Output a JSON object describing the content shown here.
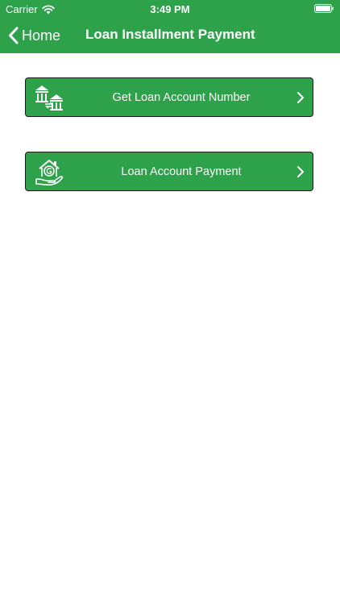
{
  "status_bar": {
    "carrier": "Carrier",
    "time": "3:49 PM"
  },
  "nav": {
    "back_label": "Home",
    "title": "Loan Installment Payment"
  },
  "menu": {
    "items": [
      {
        "label": "Get Loan Account Number",
        "icon": "bank-transfer-icon"
      },
      {
        "label": "Loan Account Payment",
        "icon": "house-hand-icon"
      }
    ]
  },
  "colors": {
    "primary": "#2ea14b",
    "border": "#1d1d1d",
    "text_on_primary": "#ffffff"
  }
}
